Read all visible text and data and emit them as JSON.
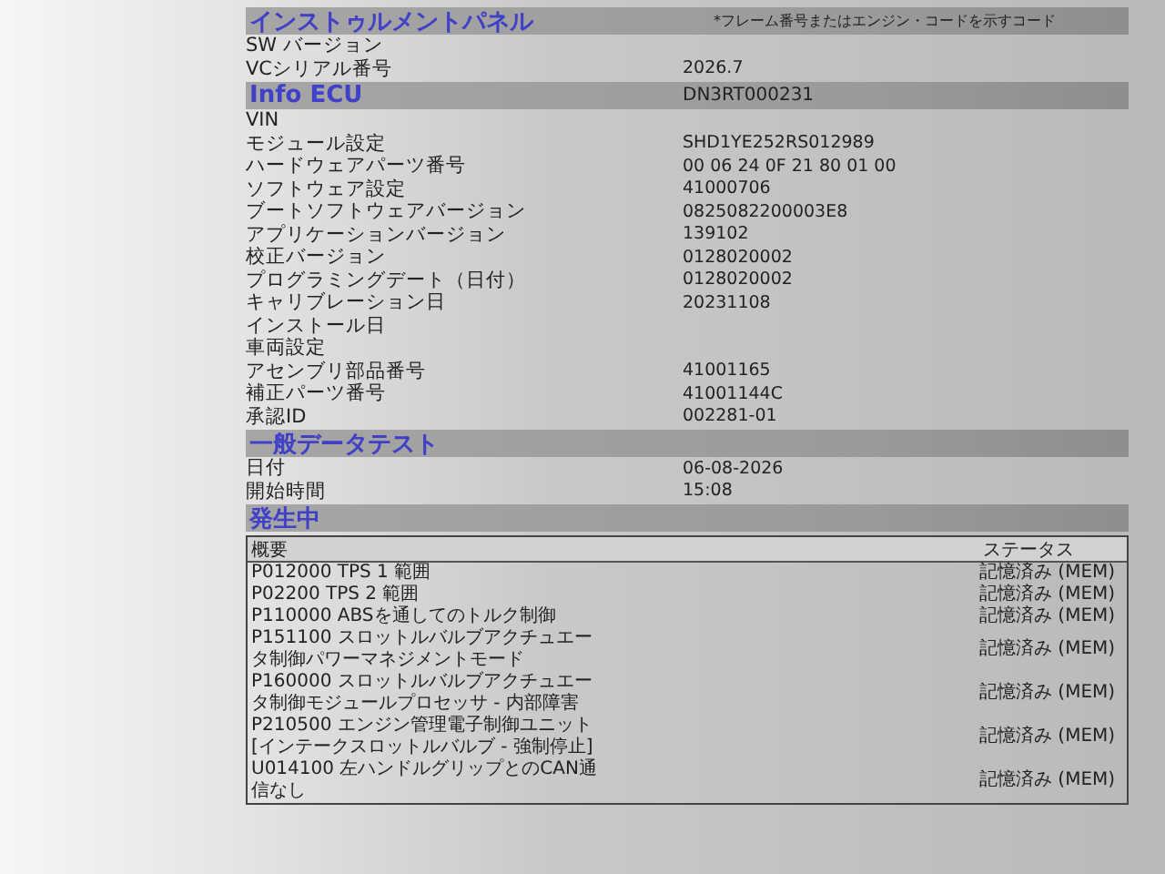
{
  "sections": [
    {
      "title": "インストゥルメントパネル",
      "note": "*フレーム番号またはエンジン・コードを示すコード",
      "rows": [
        {
          "label": "SW バージョン"
        },
        {
          "label": "VCシリアル番号",
          "value": "2026.7"
        }
      ]
    },
    {
      "title": "Info ECU",
      "value": "DN3RT000231",
      "rows": [
        {
          "label": "VIN"
        },
        {
          "label": "モジュール設定",
          "value": "SHD1YE252RS012989"
        },
        {
          "label": "ハードウェアパーツ番号",
          "value": "00 06 24 0F 21 80 01 00"
        },
        {
          "label": "ソフトウェア設定",
          "value": "41000706"
        },
        {
          "label": "ブートソフトウェアバージョン",
          "value": "0825082200003E8"
        },
        {
          "label": "アプリケーションバージョン",
          "value": "139102"
        },
        {
          "label": "校正バージョン",
          "value": "0128020002"
        },
        {
          "label": "プログラミングデート（日付）",
          "value": "0128020002"
        },
        {
          "label": "キャリブレーション日",
          "value": "20231108"
        },
        {
          "label": "インストール日"
        },
        {
          "label": "車両設定"
        },
        {
          "label": "アセンブリ部品番号",
          "value": "41001165"
        },
        {
          "label": "補正パーツ番号",
          "value": "41001144C"
        },
        {
          "label": "承認ID",
          "value": "002281-01"
        }
      ]
    },
    {
      "title": "一般データテスト",
      "rows": [
        {
          "label": "日付",
          "value": "06-08-2026"
        },
        {
          "label": "開始時間",
          "value": "15:08"
        }
      ]
    },
    {
      "title": "発生中",
      "table": {
        "columns": [
          "概要",
          "ステータス"
        ],
        "rows": [
          {
            "description": "P012000 TPS 1 範囲",
            "status": "記憶済み (MEM)"
          },
          {
            "description": "P02200 TPS 2 範囲",
            "status": "記憶済み (MEM)"
          },
          {
            "description": "P110000 ABSを通してのトルク制御",
            "status": "記憶済み (MEM)"
          },
          {
            "description": "P151100 スロットルバルブアクチュエータ制御パワーマネジメントモード",
            "status": "記憶済み (MEM)"
          },
          {
            "description": "P160000 スロットルバルブアクチュエータ制御モジュールプロセッサ - 内部障害",
            "status": "記憶済み (MEM)"
          },
          {
            "description": "P210500 エンジン管理電子制御ユニット [インテークスロットルバルブ - 強制停止]",
            "status": "記憶済み (MEM)"
          },
          {
            "description": "U014100 左ハンドルグリップとのCAN通信なし",
            "status": "記憶済み (MEM)"
          }
        ]
      }
    }
  ]
}
